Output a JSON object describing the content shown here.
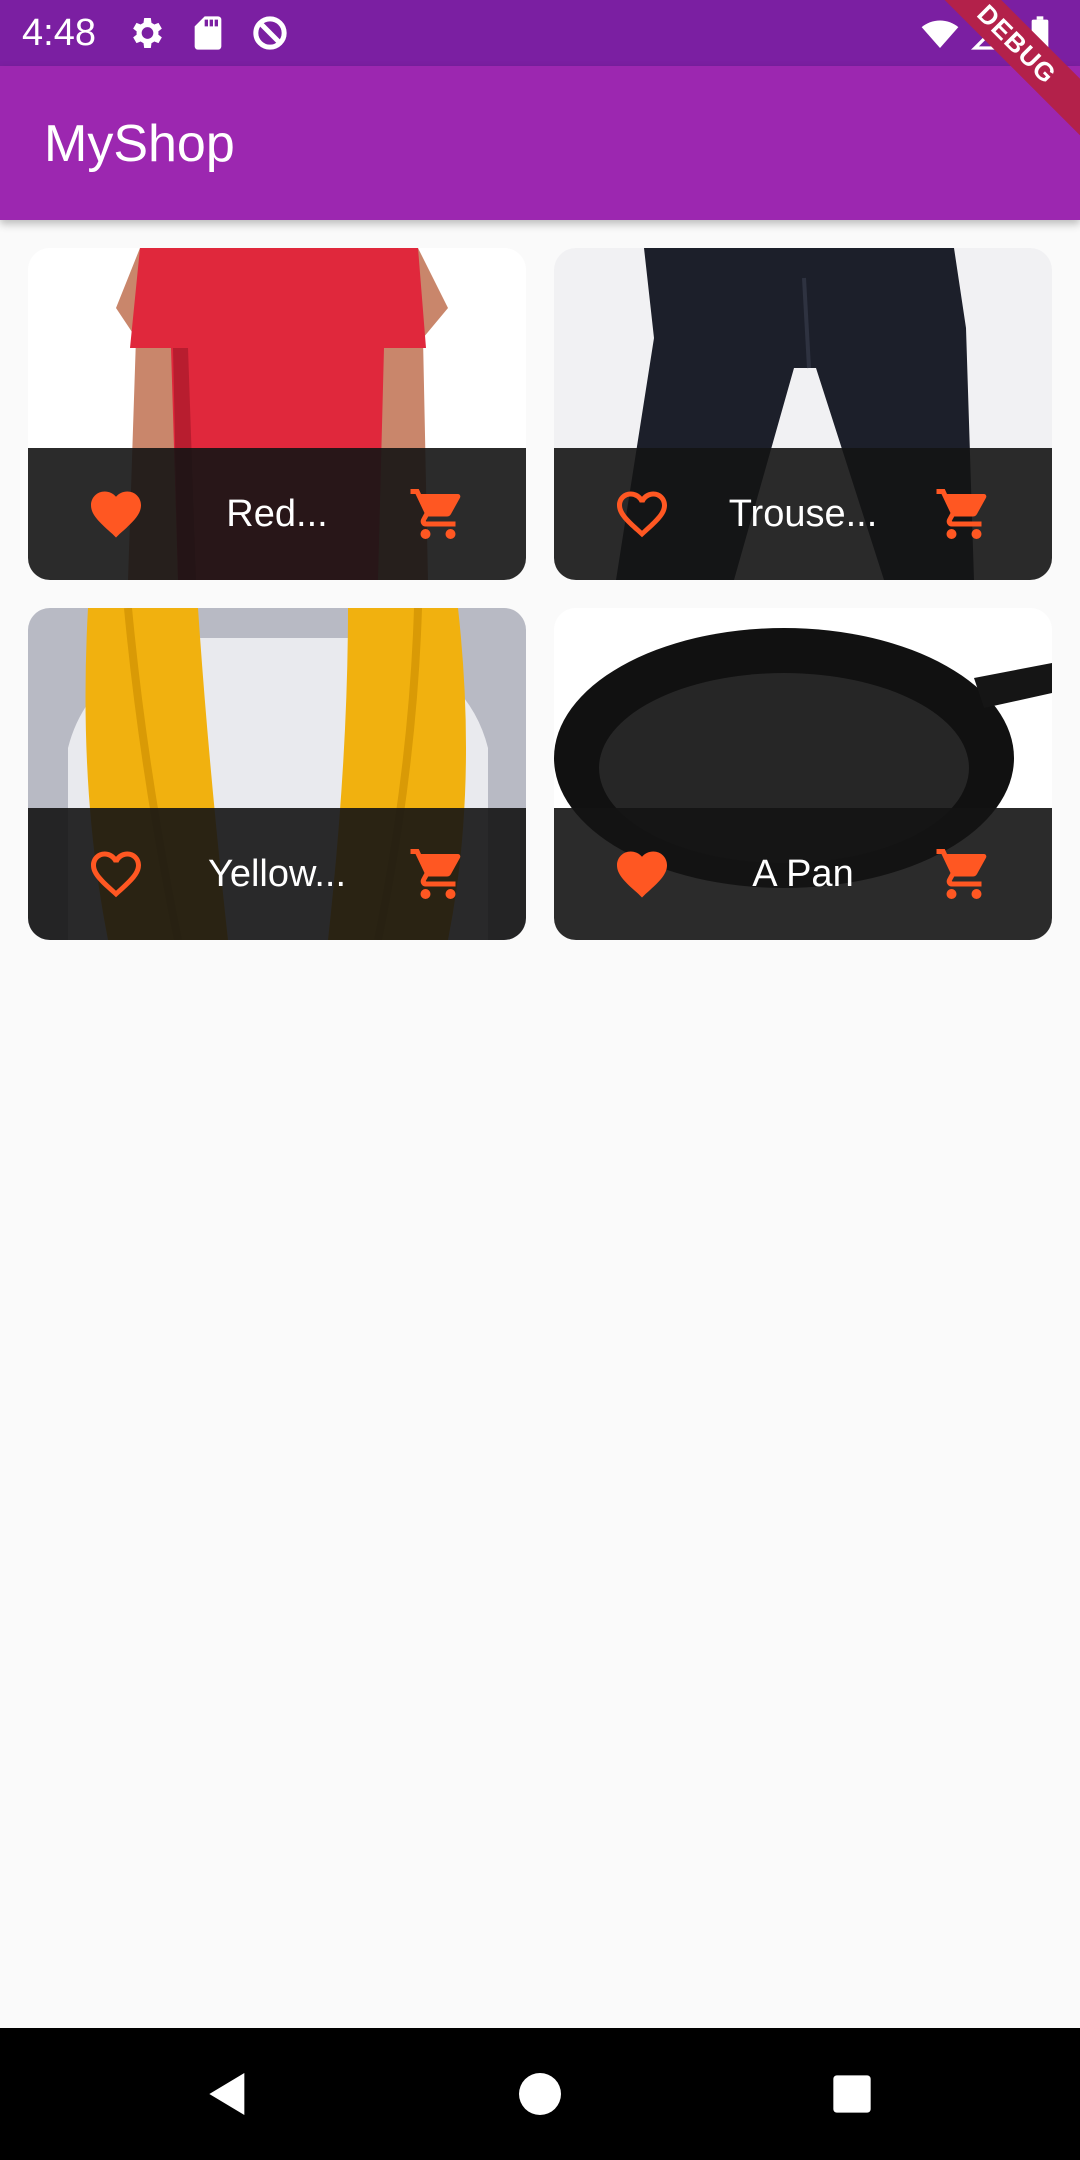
{
  "status_bar": {
    "time": "4:48",
    "left_icons": [
      "gear-icon",
      "sd-card-icon",
      "sync-disabled-icon"
    ],
    "right_icons": [
      "wifi-icon",
      "cell-signal-icon",
      "battery-icon"
    ],
    "debug_label": "DEBUG"
  },
  "app_bar": {
    "title": "MyShop"
  },
  "colors": {
    "status_bar": "#7b1fa2",
    "app_bar": "#9c27b0",
    "accent": "#ff5722",
    "card_footer": "#141414",
    "background": "#fafafa"
  },
  "products": [
    {
      "title": "Red...",
      "favorite": true,
      "image": "red t-shirt"
    },
    {
      "title": "Trouse...",
      "favorite": false,
      "image": "black trousers"
    },
    {
      "title": "Yellow...",
      "favorite": false,
      "image": "yellow scarf"
    },
    {
      "title": "A Pan",
      "favorite": true,
      "image": "cast iron pan"
    }
  ],
  "nav": {
    "icons": [
      "back-icon",
      "home-icon",
      "recents-icon"
    ]
  }
}
